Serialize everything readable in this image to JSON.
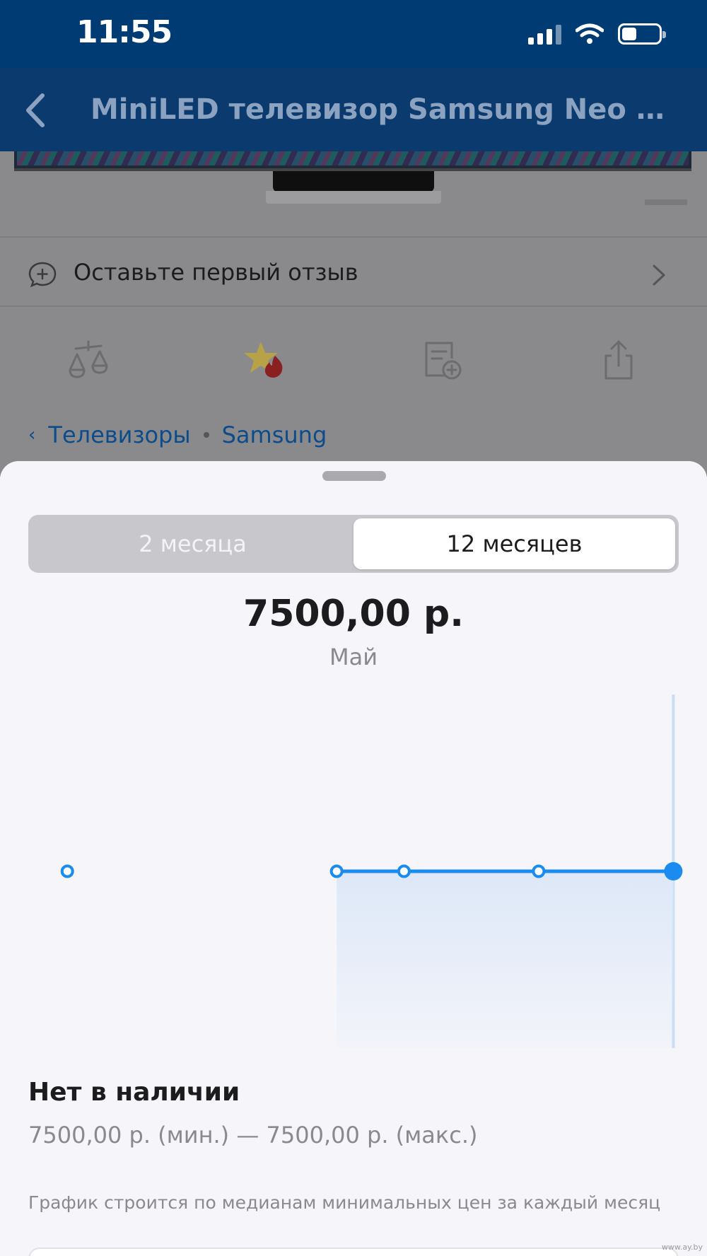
{
  "status_bar": {
    "time": "11:55"
  },
  "nav": {
    "title": "MiniLED телевизор Samsung Neo QL..."
  },
  "product": {
    "review_prompt": "Оставьте первый отзыв",
    "actions": [
      "compare-icon",
      "favorite-icon",
      "add-note-icon",
      "share-icon"
    ]
  },
  "breadcrumbs": [
    "Телевизоры",
    "Samsung"
  ],
  "price_sheet": {
    "tabs": [
      {
        "label": "2 месяца",
        "active": false
      },
      {
        "label": "12 месяцев",
        "active": true
      }
    ],
    "selected_price": "7500,00 р.",
    "selected_month": "Май",
    "availability": "Нет в наличии",
    "price_range": "7500,00 р. (мин.) — 7500,00 р. (макс.)",
    "footnote": "График строится по медианам минимальных цен за каждый месяц"
  },
  "chart_data": {
    "type": "area",
    "title": "",
    "xlabel": "",
    "ylabel": "",
    "x": [
      0,
      4,
      5,
      7,
      9
    ],
    "series": [
      {
        "values": [
          7500,
          7500,
          7500,
          7500,
          7500
        ]
      }
    ],
    "xlim": [
      -1,
      9.5
    ],
    "selected_index": 4,
    "line_color": "#1a8cf0",
    "fill_color": "#dde8f8",
    "grid": false
  },
  "watermark": "www.ay.by",
  "colors": {
    "status_bar": "#003b74",
    "accent": "#1a8cf0",
    "link": "#0d4c8a"
  }
}
